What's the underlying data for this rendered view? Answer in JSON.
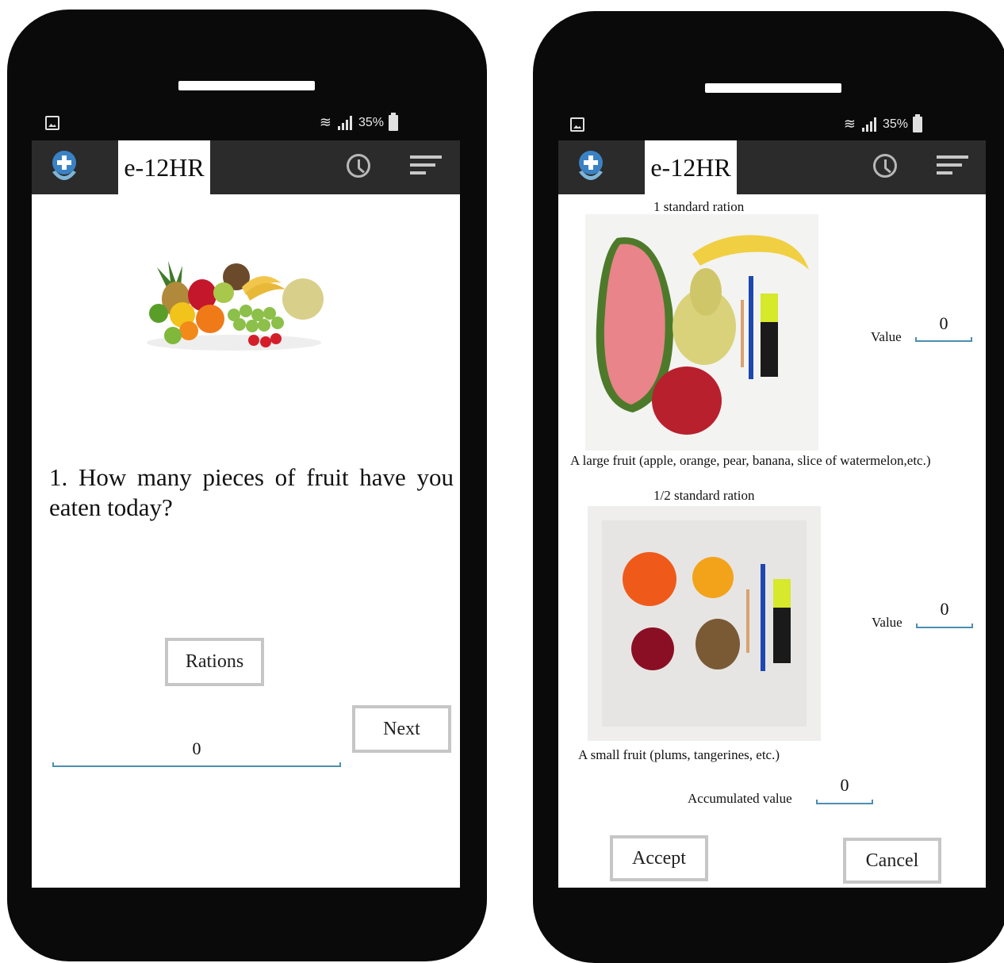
{
  "status": {
    "battery": "35%"
  },
  "app": {
    "title": "e-12HR"
  },
  "icons": {
    "logo": "medical-cross-logo-icon",
    "history": "clock-icon",
    "menu": "sort-menu-icon"
  },
  "colors": {
    "phone": "#0a0a0a",
    "appbar": "#2b2b2b",
    "accent_line": "#4a8fb0",
    "button_border": "#c6c6c6"
  },
  "question_screen": {
    "question": "1. How many pieces of fruit have you eaten today?",
    "rations_button": "Rations",
    "next_button": "Next",
    "answer_value": "0"
  },
  "rations_screen": {
    "standard": {
      "heading": "1 standard ration",
      "description": "A large fruit (apple, orange, pear, banana, slice of watermelon,etc.)",
      "value_label": "Value",
      "value": "0"
    },
    "half": {
      "heading": "1/2 standard ration",
      "description": "A small fruit (plums, tangerines, etc.)",
      "value_label": "Value",
      "value": "0"
    },
    "accumulated_label": "Accumulated value",
    "accumulated_value": "0",
    "accept_button": "Accept",
    "cancel_button": "Cancel"
  }
}
